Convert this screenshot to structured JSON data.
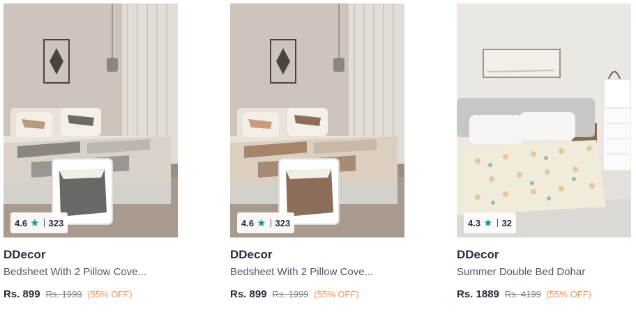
{
  "products": [
    {
      "brand": "DDecor",
      "name": "Bedsheet With 2 Pillow Cove...",
      "rating": "4.6",
      "rating_count": "323",
      "price": "Rs. 899",
      "mrp": "Rs. 1999",
      "discount": "(55% OFF)"
    },
    {
      "brand": "DDecor",
      "name": "Bedsheet With 2 Pillow Cove...",
      "rating": "4.6",
      "rating_count": "323",
      "price": "Rs. 899",
      "mrp": "Rs. 1999",
      "discount": "(55% OFF)"
    },
    {
      "brand": "DDecor",
      "name": "Summer Double Bed Dohar",
      "rating": "4.3",
      "rating_count": "32",
      "price": "Rs. 1889",
      "mrp": "Rs. 4199",
      "discount": "(55% OFF)"
    }
  ],
  "icons": {
    "rating_star": "star-icon"
  },
  "colors": {
    "star": "#14958f",
    "discount": "#ff905a",
    "brand": "#282c3f"
  }
}
